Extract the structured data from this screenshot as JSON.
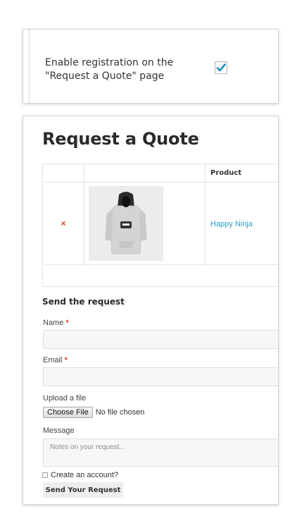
{
  "settings": {
    "enable_registration_label": "Enable registration on the \"Request a Quote\" page",
    "enable_registration_checked": true
  },
  "quote": {
    "title": "Request a Quote",
    "table": {
      "columns": [
        "",
        "",
        "Product"
      ],
      "rows": [
        {
          "remove_symbol": "×",
          "image": "hoodie-icon",
          "product": "Happy Ninja"
        }
      ]
    },
    "form": {
      "heading": "Send the request",
      "name_label": "Name",
      "email_label": "Email",
      "required_mark": "*",
      "upload_label": "Upload a file",
      "choose_file_button": "Choose File",
      "no_file_text": "No file chosen",
      "message_label": "Message",
      "message_placeholder": "Notes on your request...",
      "create_account_label": "Create an account?",
      "submit_label": "Send Your Request"
    }
  },
  "colors": {
    "accent_link": "#2a9dc4",
    "remove_red": "#e2401c",
    "check_blue": "#1e8cbe"
  }
}
